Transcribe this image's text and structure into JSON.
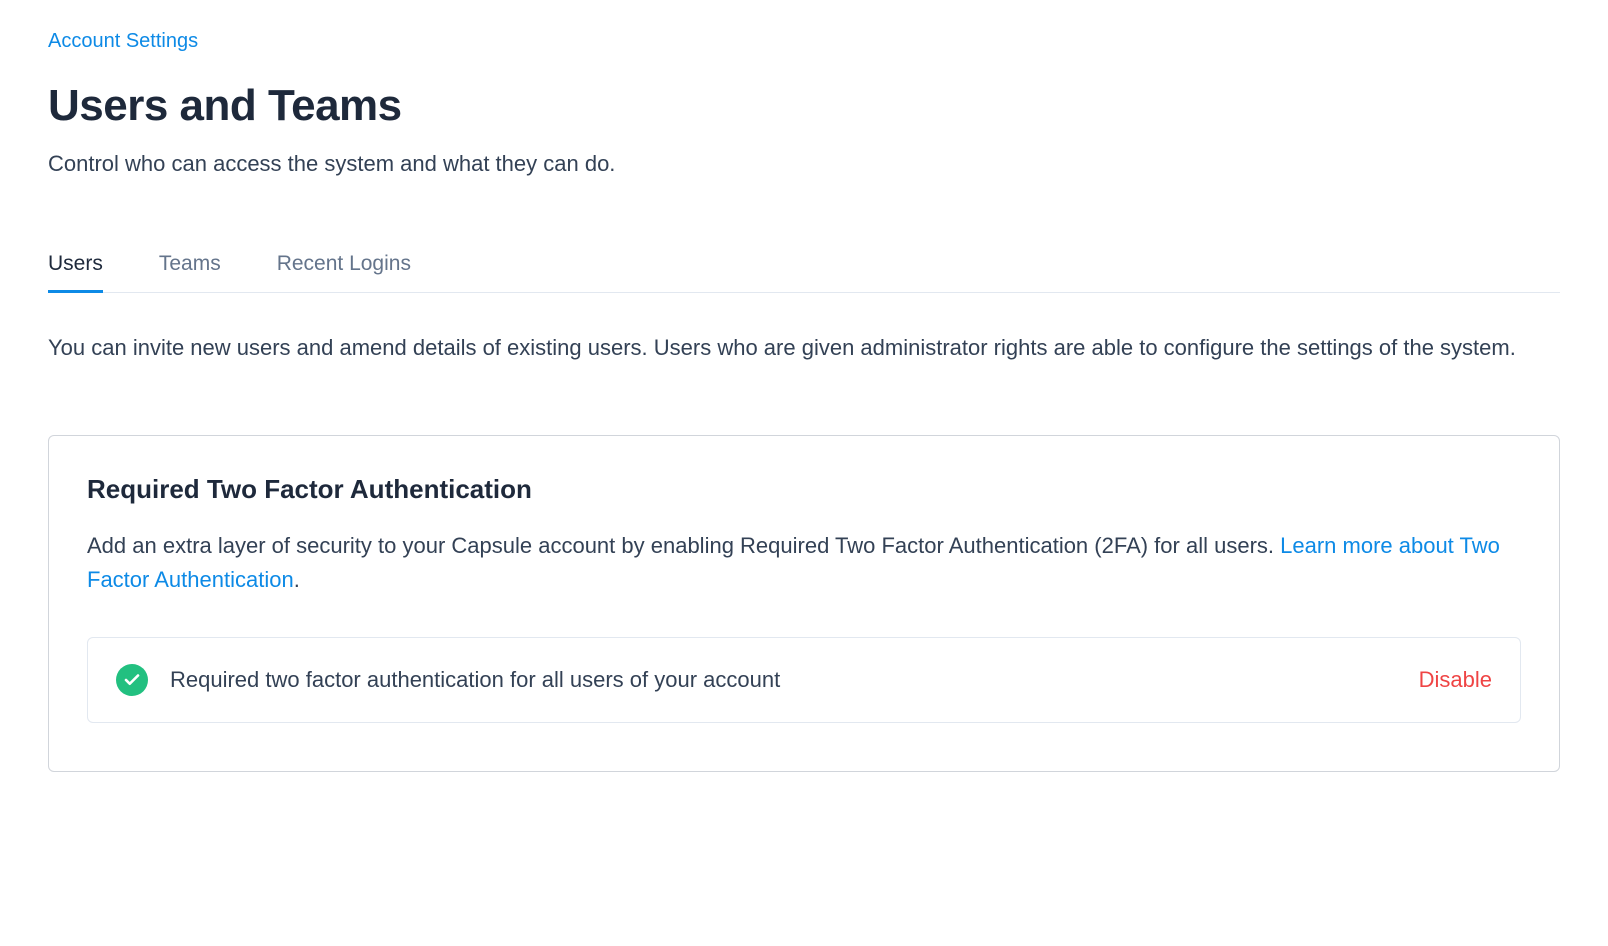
{
  "breadcrumb": {
    "label": "Account Settings"
  },
  "header": {
    "title": "Users and Teams",
    "subtitle": "Control who can access the system and what they can do."
  },
  "tabs": [
    {
      "label": "Users",
      "active": true
    },
    {
      "label": "Teams",
      "active": false
    },
    {
      "label": "Recent Logins",
      "active": false
    }
  ],
  "content": {
    "description": "You can invite new users and amend details of existing users. Users who are given administrator rights are able to configure the settings of the system."
  },
  "twofa": {
    "title": "Required Two Factor Authentication",
    "description_text": "Add an extra layer of security to your Capsule account by enabling Required Two Factor Authentication (2FA) for all users. ",
    "learn_more_link": "Learn more about Two Factor Authentication",
    "period": ".",
    "status_text": "Required two factor authentication for all users of your account",
    "disable_label": "Disable"
  }
}
